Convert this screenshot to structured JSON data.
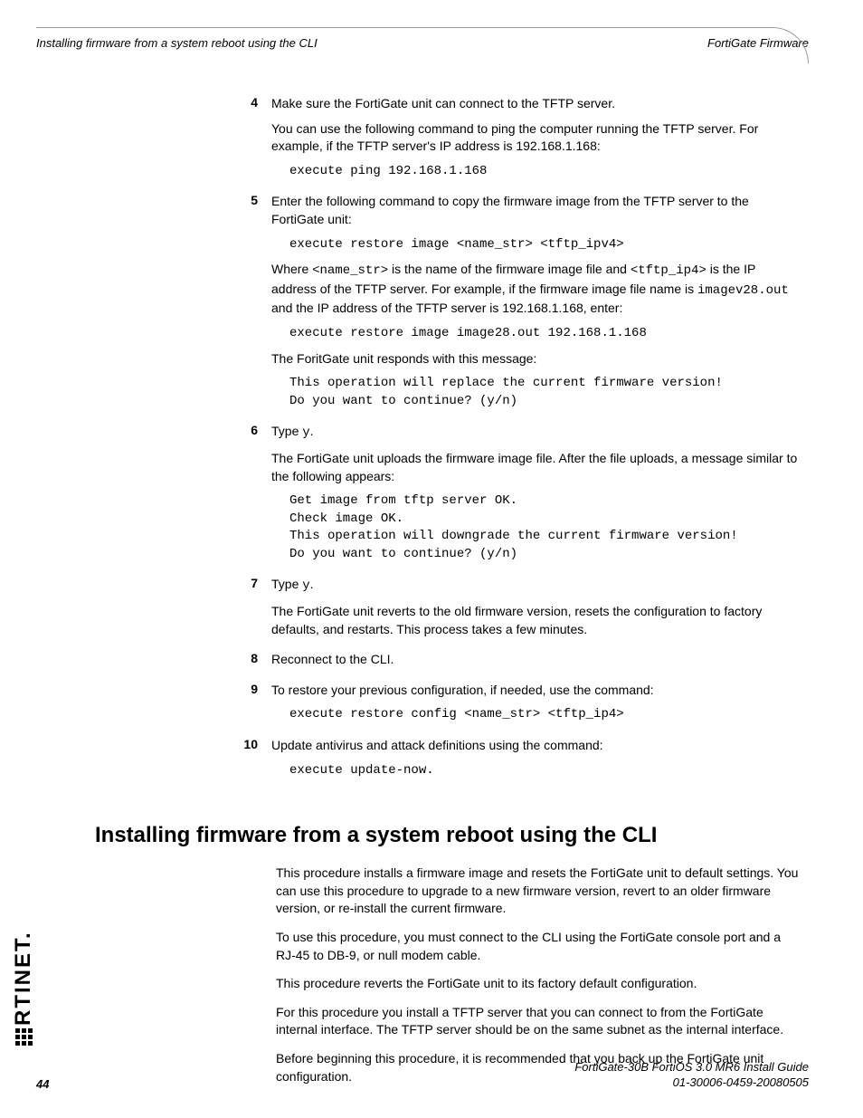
{
  "header": {
    "left": "Installing firmware from a system reboot using the CLI",
    "right": "FortiGate Firmware"
  },
  "steps": [
    {
      "num": "4",
      "p1": "Make sure the FortiGate unit can connect to the TFTP server.",
      "p2": "You can use the following command to ping the computer running the TFTP server. For example, if the TFTP server's IP address is 192.168.1.168:",
      "code1": "execute ping 192.168.1.168"
    },
    {
      "num": "5",
      "p1": "Enter the following command to copy the firmware image from the TFTP server to the FortiGate unit:",
      "code1": "execute restore image <name_str> <tftp_ipv4>",
      "p2a": "Where ",
      "p2_code1": "<name_str>",
      "p2b": " is the name of the firmware image file and ",
      "p2_code2": "<tftp_ip4>",
      "p2c": " is the IP address of the TFTP server. For example, if the firmware image file name is ",
      "p2_code3": "imagev28.out",
      "p2d": " and the IP address of the TFTP server is 192.168.1.168, enter:",
      "code2": "execute restore image image28.out 192.168.1.168",
      "p3": "The ForitGate unit responds with this message:",
      "code3a": "This operation will replace the current firmware version!",
      "code3b": "Do you want to continue? (y/n)"
    },
    {
      "num": "6",
      "p1a": "Type ",
      "p1_code": "y",
      "p1b": ".",
      "p2": "The FortiGate unit uploads the firmware image file. After the file uploads, a message similar to the following appears:",
      "code1a": "Get image from tftp server OK.",
      "code1b": "Check image OK.",
      "code1c": "This operation will downgrade the current firmware version!",
      "code1d": "Do you want to continue? (y/n)"
    },
    {
      "num": "7",
      "p1a": "Type ",
      "p1_code": "y",
      "p1b": ".",
      "p2": "The FortiGate unit reverts to the old firmware version, resets the configuration to factory defaults, and restarts. This process takes a few minutes."
    },
    {
      "num": "8",
      "p1": "Reconnect to the CLI."
    },
    {
      "num": "9",
      "p1": "To restore your previous configuration, if needed, use the command:",
      "code1": "execute restore config <name_str> <tftp_ip4>"
    },
    {
      "num": "10",
      "p1": "Update antivirus and attack definitions using the command:",
      "code1": "execute update-now."
    }
  ],
  "section": {
    "heading": "Installing firmware from a system reboot using the CLI",
    "p1": "This procedure installs a firmware image and resets the FortiGate unit to default settings. You can use this procedure to upgrade to a new firmware version, revert to an older firmware version, or re-install the current firmware.",
    "p2": "To use this procedure, you must connect to the CLI using the FortiGate console port and a RJ-45 to DB-9, or null modem cable.",
    "p3": "This procedure reverts the FortiGate unit to its factory default configuration.",
    "p4": "For this procedure you install a TFTP server that you can connect to from the FortiGate internal interface. The TFTP server should be on the same subnet as the internal interface.",
    "p5": "Before beginning this procedure, it is recommended that you back up the FortiGate unit configuration."
  },
  "logo": {
    "text": "RTINET"
  },
  "footer": {
    "page": "44",
    "line1": "FortiGate-30B FortiOS 3.0 MR6 Install Guide",
    "line2": "01-30006-0459-20080505"
  }
}
